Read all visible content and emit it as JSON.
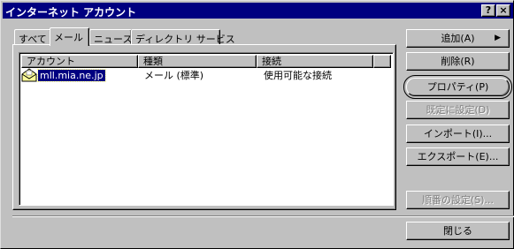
{
  "window": {
    "title": "インターネット アカウント",
    "help_button": "?",
    "close_button": "×"
  },
  "tabs": [
    {
      "label": "すべて",
      "active": false
    },
    {
      "label": "メール",
      "active": true
    },
    {
      "label": "ニュース",
      "active": false
    },
    {
      "label": "ディレクトリ サービス",
      "active": false
    }
  ],
  "list": {
    "columns": [
      "アカウント",
      "種類",
      "接続"
    ],
    "rows": [
      {
        "account": "mll.mia.ne.jp",
        "type": "メール (標準)",
        "connection": "使用可能な接続",
        "icon": "mail-account-icon",
        "selected": true
      }
    ]
  },
  "buttons": {
    "add": "追加(A)",
    "remove": "削除(R)",
    "properties": "プロパティ(P)",
    "set_default": "既定に設定(D)",
    "import": "インポート(I)...",
    "export": "エクスポート(E)...",
    "set_order": "順番の設定(S)...",
    "close": "閉じる"
  },
  "colors": {
    "titlebar": "#000080",
    "face": "#c0c0c0",
    "selection": "#000080"
  }
}
